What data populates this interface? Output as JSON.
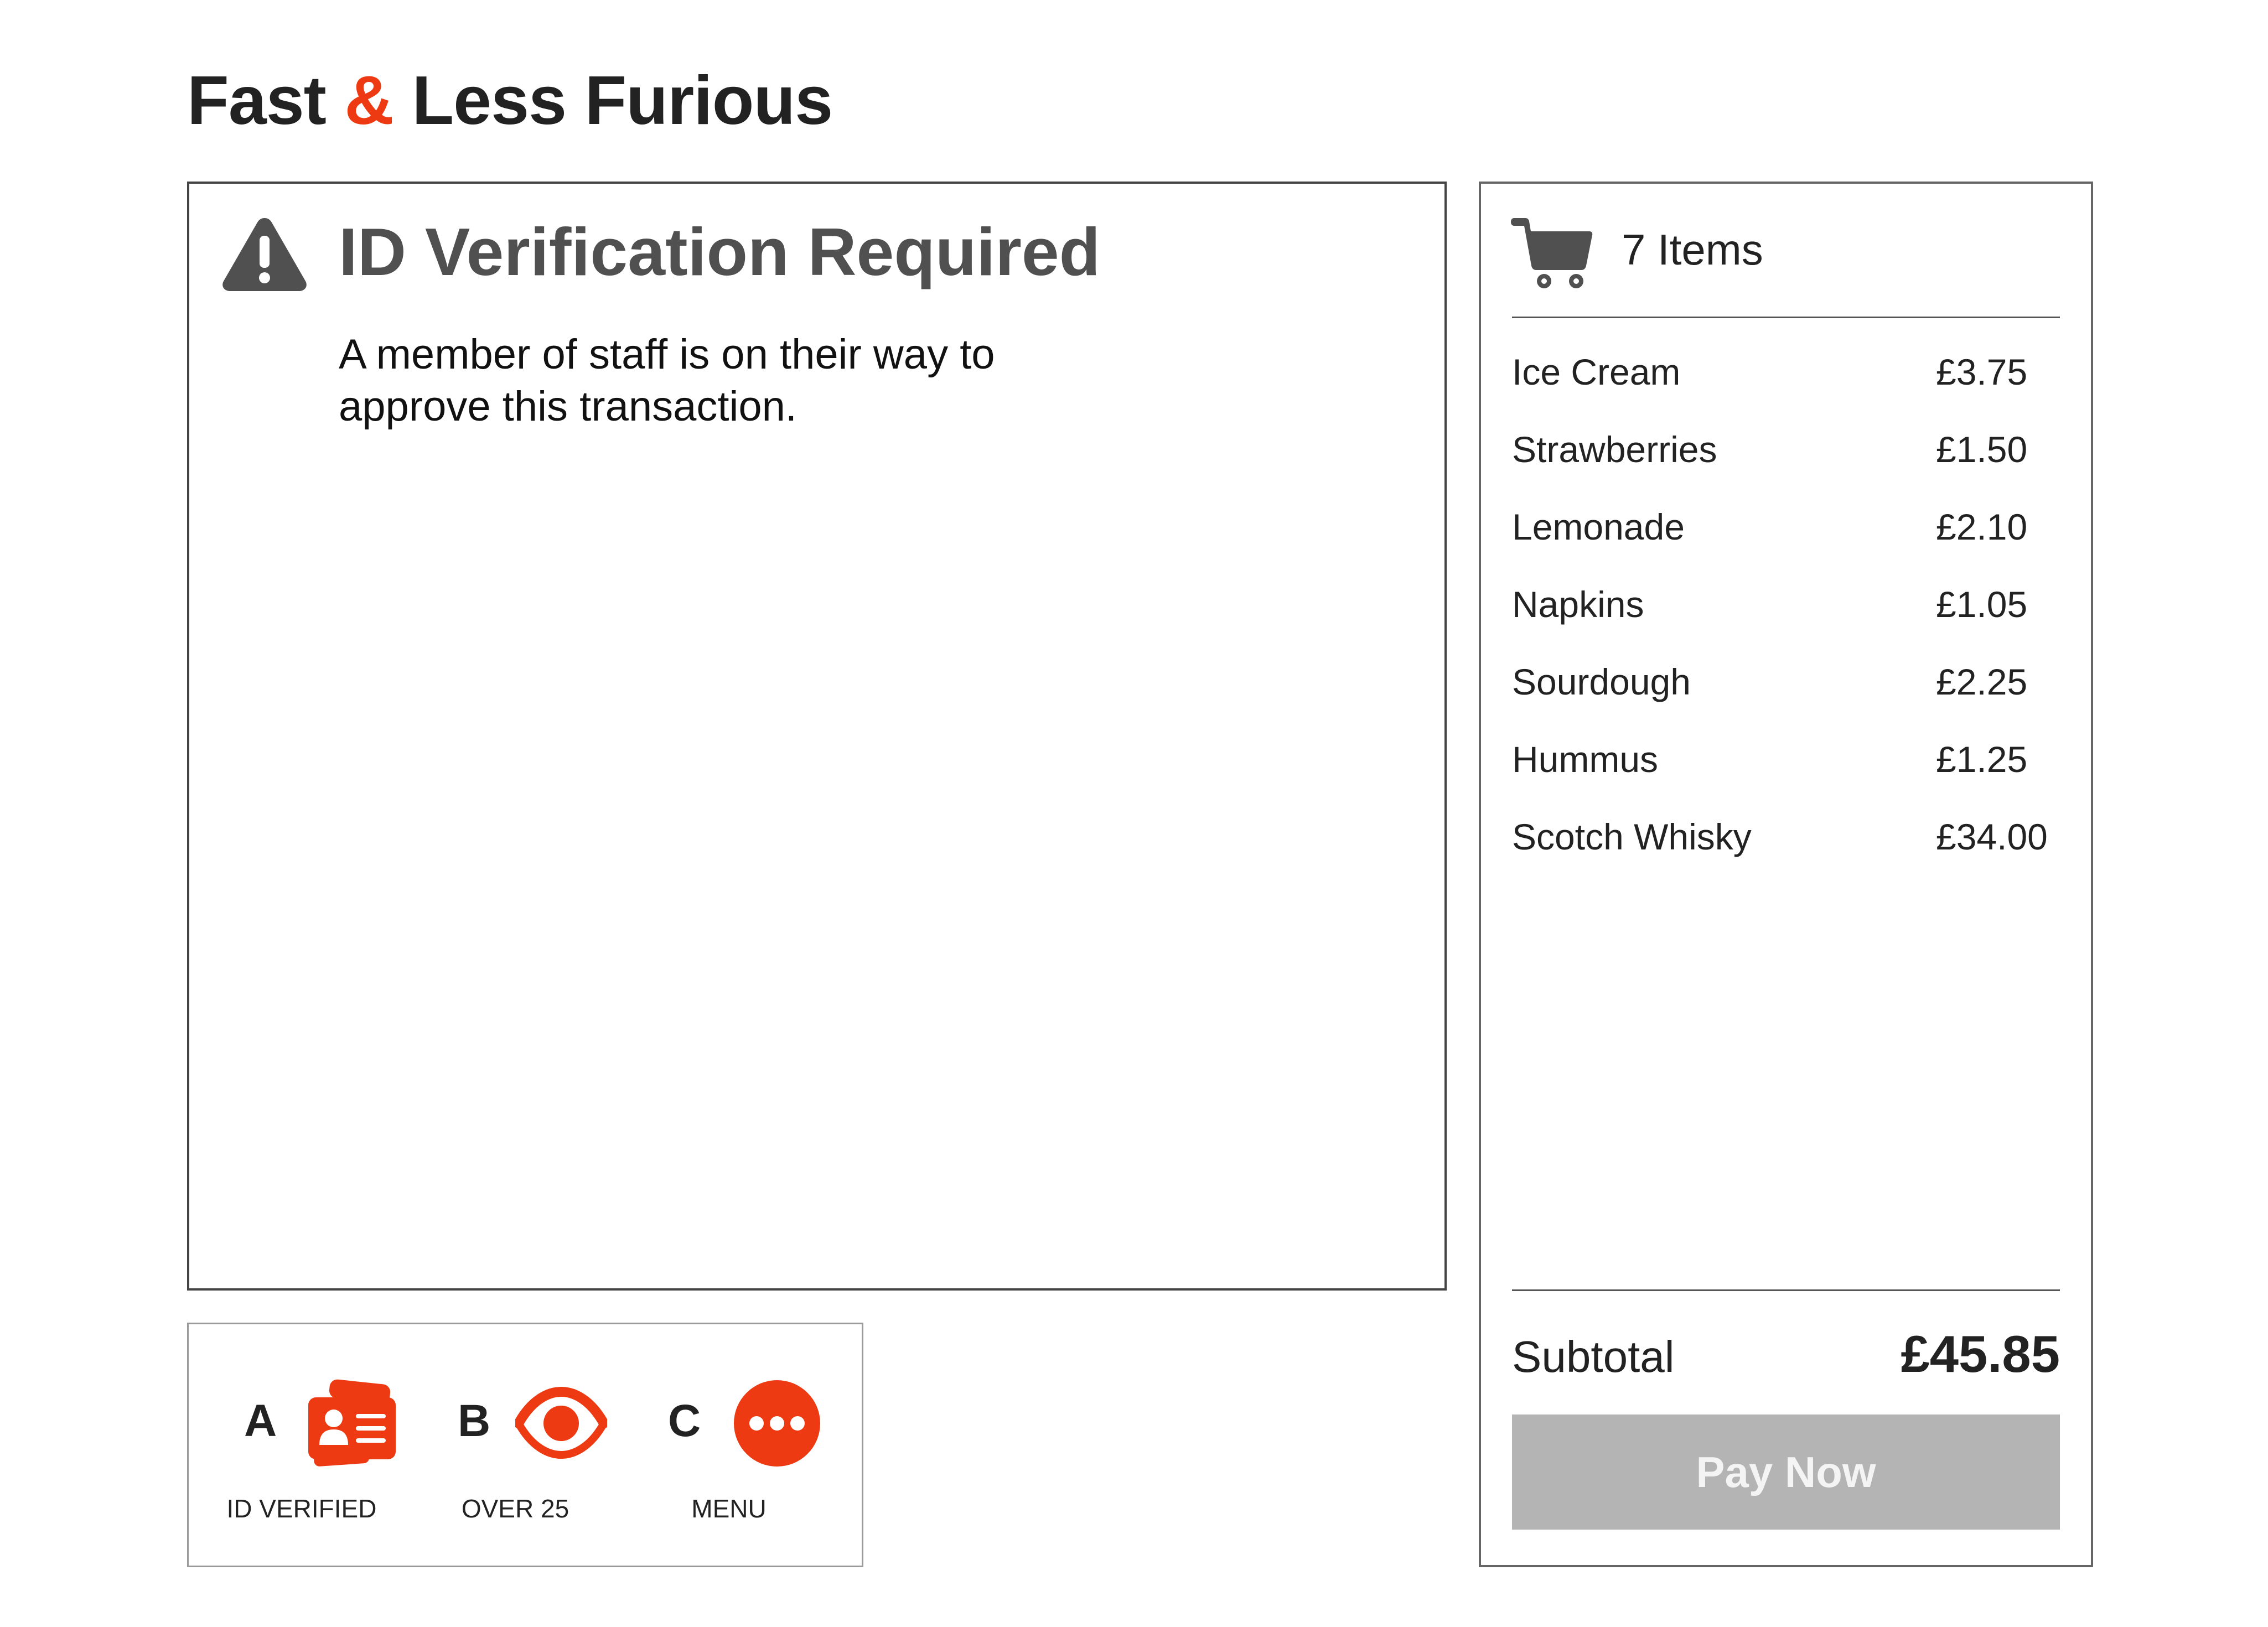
{
  "app": {
    "title_part1": "Fast ",
    "title_amp": "&",
    "title_part2": " Less Furious"
  },
  "colors": {
    "accent": "#ee3a12",
    "dark_text": "#222222",
    "heading_gray": "#505050",
    "button_disabled": "#b4b4b4"
  },
  "alert": {
    "icon": "warning-icon",
    "heading": "ID Verification Required",
    "message": "A member of staff is on their way to approve this transaction."
  },
  "cart": {
    "icon": "cart-icon",
    "count_label": "7 Items",
    "items": [
      {
        "name": "Ice Cream",
        "price": "£3.75"
      },
      {
        "name": "Strawberries",
        "price": "£1.50"
      },
      {
        "name": "Lemonade",
        "price": "£2.10"
      },
      {
        "name": "Napkins",
        "price": "£1.05"
      },
      {
        "name": "Sourdough",
        "price": "£2.25"
      },
      {
        "name": "Hummus",
        "price": "£1.25"
      },
      {
        "name": "Scotch Whisky",
        "price": "£34.00"
      }
    ],
    "subtotal_label": "Subtotal",
    "subtotal_value": "£45.85",
    "pay_label": "Pay Now",
    "pay_enabled": false
  },
  "actions": [
    {
      "key": "A",
      "icon": "id-card-icon",
      "label": "ID VERIFIED"
    },
    {
      "key": "B",
      "icon": "eye-icon",
      "label": "OVER 25"
    },
    {
      "key": "C",
      "icon": "more-icon",
      "label": "MENU"
    }
  ]
}
